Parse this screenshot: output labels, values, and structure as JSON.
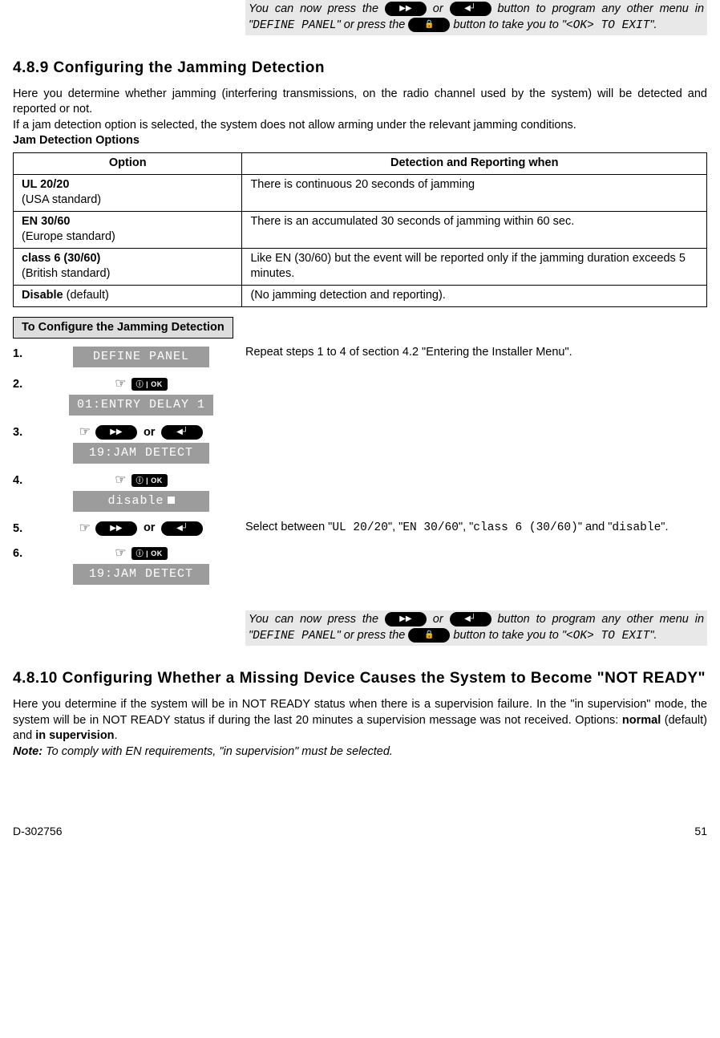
{
  "topNote": {
    "t1": "You can now press the ",
    "t2": " or ",
    "t3": " button to program any other menu in \"",
    "menu": "DEFINE PANEL",
    "t4": "\" or press the ",
    "t5": " button to take you to \"",
    "exit": "<OK> TO EXIT",
    "t6": "\"."
  },
  "section489": {
    "heading": "4.8.9 Configuring the Jamming Detection",
    "p1": "Here you determine whether jamming (interfering transmissions, on the radio channel used by the system) will be detected and reported or not.",
    "p2": "If a jam detection option is selected, the system does not allow arming under the relevant jamming conditions.",
    "tableTitle": "Jam Detection Options",
    "th1": "Option",
    "th2": "Detection and Reporting when",
    "rows": [
      {
        "opt1": "UL 20/20",
        "opt2": "(USA standard)",
        "desc": "There is continuous 20 seconds of jamming"
      },
      {
        "opt1": "EN 30/60",
        "opt2": "(Europe standard)",
        "desc": "There is an accumulated 30 seconds of jamming within 60 sec."
      },
      {
        "opt1": "class 6 (30/60)",
        "opt2": "(British standard)",
        "desc": "Like EN (30/60) but the event will be reported only if the jamming duration exceeds 5 minutes."
      },
      {
        "opt1": "Disable",
        "opt2": "  (default)",
        "desc": "(No jamming detection and reporting)."
      }
    ],
    "subhead": "To Configure the Jamming Detection",
    "steps": {
      "s1": {
        "num": "1.",
        "lcd": "DEFINE PANEL",
        "desc": "Repeat steps 1 to 4 of section 4.2 \"Entering the Installer Menu\"."
      },
      "s2": {
        "num": "2.",
        "lcd": "01:ENTRY DELAY 1"
      },
      "s3": {
        "num": "3.",
        "or": "or",
        "lcd": "19:JAM DETECT"
      },
      "s4": {
        "num": "4.",
        "lcd": "disable"
      },
      "s5": {
        "num": "5.",
        "or": "or",
        "d1": "Select between \"",
        "o1": "UL 20/20",
        "d2": "\", \"",
        "o2": "EN 30/60",
        "d3": "\", \"",
        "o3": "class 6 (30/60)",
        "d4": "\" and \"",
        "o4": "disable",
        "d5": "\"."
      },
      "s6": {
        "num": "6.",
        "lcd": "19:JAM DETECT"
      }
    }
  },
  "btn": {
    "fwd": "▶▶",
    "back": "◀┘",
    "lock": "🔒",
    "ok": "ⓘ | OK"
  },
  "section4810": {
    "heading": "4.8.10 Configuring Whether a Missing Device Causes the System to Become \"NOT READY\"",
    "p1a": "Here you determine if the system will be in NOT READY status when there is a supervision failure. In the \"in supervision\" mode, the system will be in NOT READY status if during the last 20 minutes a supervision message was not received. Options: ",
    "p1b": "normal",
    "p1c": " (default) and ",
    "p1d": "in supervision",
    "p1e": ".",
    "noteLabel": "Note:",
    "noteText": " To comply with EN requirements, \"in supervision\" must be selected."
  },
  "footer": {
    "doc": "D-302756",
    "page": "51"
  }
}
